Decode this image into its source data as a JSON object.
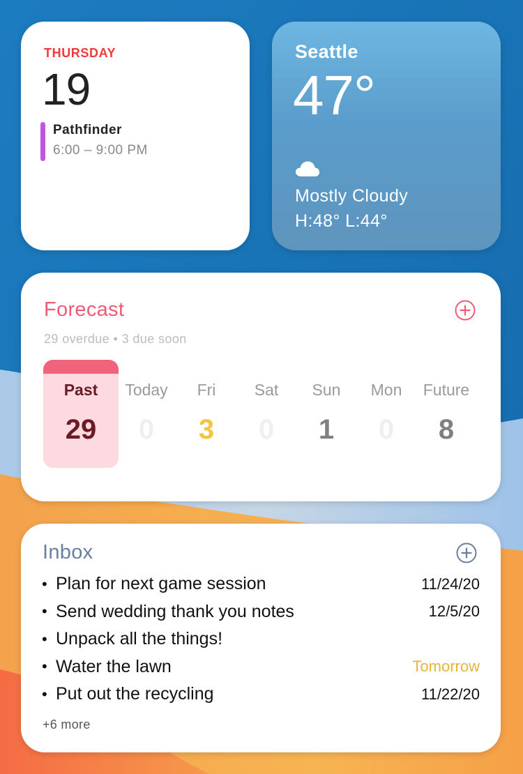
{
  "colors": {
    "calendar_accent": "#f2393a",
    "event_bar": "#bf55e0",
    "forecast_accent": "#ef5b72",
    "forecast_past_bg": "#fdd9e0",
    "forecast_past_header": "#f1637a",
    "forecast_past_text": "#6a1b26",
    "soon_yellow": "#f5c542",
    "inbox_accent": "#6a7fa0"
  },
  "calendar": {
    "weekday": "THURSDAY",
    "date": "19",
    "event": {
      "title": "Pathfinder",
      "time": "6:00 – 9:00 PM"
    }
  },
  "weather": {
    "city": "Seattle",
    "temperature": "47°",
    "condition_icon": "cloud-icon",
    "condition": "Mostly Cloudy",
    "high_low": "H:48° L:44°"
  },
  "forecast": {
    "title": "Forecast",
    "add_icon": "plus-circle-icon",
    "subtitle": "29 overdue • 3 due soon",
    "columns": [
      {
        "label": "Past",
        "count": "29",
        "color": "#6a1b26"
      },
      {
        "label": "Today",
        "count": "0",
        "color": "#efefef"
      },
      {
        "label": "Fri",
        "count": "3",
        "color": "#f5c542"
      },
      {
        "label": "Sat",
        "count": "0",
        "color": "#efefef"
      },
      {
        "label": "Sun",
        "count": "1",
        "color": "#808080"
      },
      {
        "label": "Mon",
        "count": "0",
        "color": "#efefef"
      },
      {
        "label": "Future",
        "count": "8",
        "color": "#808080"
      }
    ]
  },
  "inbox": {
    "title": "Inbox",
    "add_icon": "plus-circle-icon",
    "bullet": "•",
    "items": [
      {
        "text": "Plan for next game session",
        "due": "11/24/20",
        "soon": false
      },
      {
        "text": "Send wedding thank you notes",
        "due": "12/5/20",
        "soon": false
      },
      {
        "text": "Unpack all the things!",
        "due": "",
        "soon": false
      },
      {
        "text": "Water the lawn",
        "due": "Tomorrow",
        "soon": true
      },
      {
        "text": "Put out the recycling",
        "due": "11/22/20",
        "soon": false
      }
    ],
    "more": "+6 more"
  }
}
